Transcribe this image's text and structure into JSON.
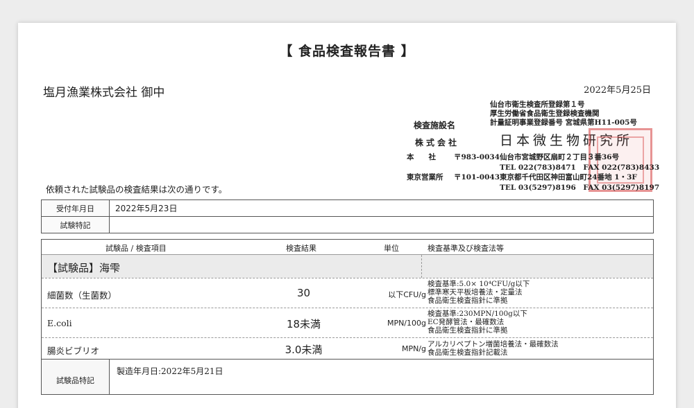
{
  "report": {
    "title": "【 食品検査報告書 】",
    "recipient": "塩月漁業株式会社 御中",
    "issue_date": "2022年5月25日",
    "registrations": [
      "仙台市衛生検査所登録第１号",
      "厚生労働省食品衛生登録検査機関",
      "計量証明事業登録番号 宮城県第H11-005号"
    ],
    "facility_label": "検査施設名",
    "company_kind": "株式会社",
    "lab_name": "日本微生物研究所",
    "offices": [
      {
        "label": "本　　社",
        "zip": "〒983-0034",
        "address": "仙台市宮城野区扇町２丁目３番36号",
        "contact": "TEL 022(783)8471　FAX 022(783)8433"
      },
      {
        "label": "東京営業所",
        "zip": "〒101-0043",
        "address": "東京都千代田区神田富山町24番地 1・3F",
        "contact": "TEL 03(5297)8196　FAX 03(5297)8197"
      }
    ],
    "intro": "依頼された試験品の検査結果は次の通りです。",
    "received_label": "受付年月日",
    "received_value": "2022年5月23日",
    "notes_label": "試験特記",
    "notes_value": ""
  },
  "results": {
    "headers": {
      "item": "試験品 / 検査項目",
      "result": "検査結果",
      "unit": "単位",
      "method": "検査基準及び検査法等"
    },
    "category": "【試験品】海雫",
    "items": [
      {
        "name": "細菌数（生菌数）",
        "result": "30",
        "unit": "以下CFU/g",
        "method": [
          "検査基準:5.0× 10⁴CFU/g以下",
          "標準寒天平板培養法・定量法",
          "食品衛生検査指針に準拠"
        ]
      },
      {
        "name": "E.coli",
        "result": "18未満",
        "unit": "MPN/100g",
        "method": [
          "検査基準:230MPN/100g以下",
          "EC発酵管法・最確数法",
          "食品衛生検査指針に準拠"
        ]
      },
      {
        "name": "腸炎ビブリオ",
        "result": "3.0未満",
        "unit": "MPN/g",
        "method": [
          "アルカリペプトン増菌培養法・最確数法",
          "食品衛生検査指針記載法"
        ]
      }
    ],
    "special_label": "試験品特記",
    "special_value": "製造年月日:2022年5月21日"
  }
}
